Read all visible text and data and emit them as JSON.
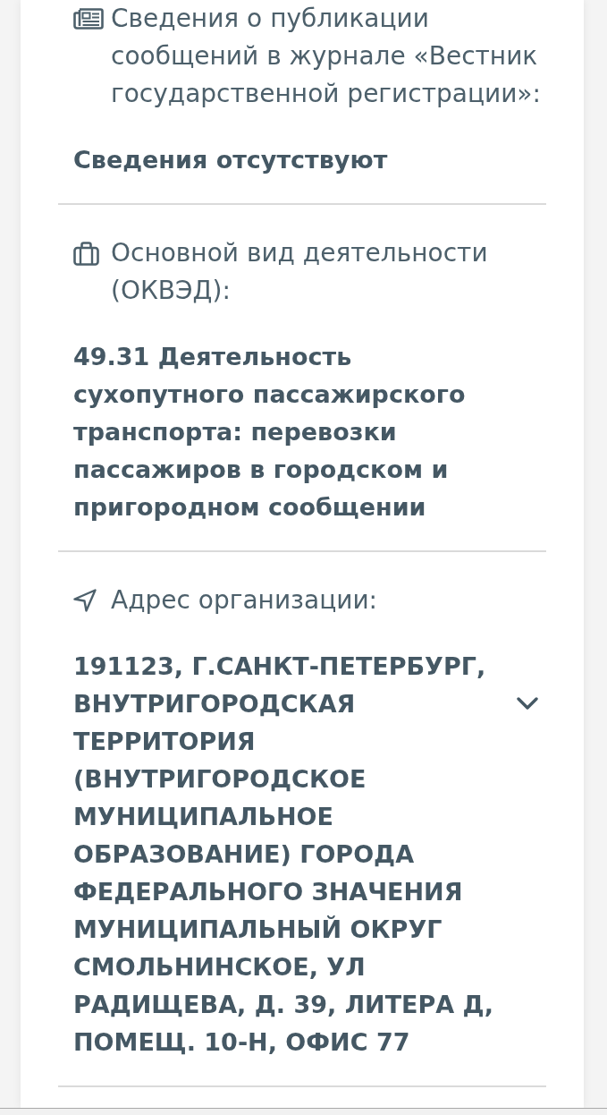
{
  "publication_info": {
    "label": "Сведения о публикации сообщений в журнале «Вестник государственной регистрации»:",
    "value": "Сведения отсутствуют"
  },
  "main_activity": {
    "label": "Основной вид деятельности (ОКВЭД):",
    "value": "49.31 Деятельность сухопутного пассажирского транспорта: перевозки пассажиров в городском и пригородном сообщении"
  },
  "organization_address": {
    "label": "Адрес организации:",
    "value": "191123, Г.САНКТ-ПЕТЕРБУРГ, ВНУТРИГОРОДСКАЯ ТЕРРИТОРИЯ (ВНУТРИГОРОДСКОЕ МУНИЦИПАЛЬНОЕ ОБРАЗОВАНИЕ) ГОРОДА ФЕДЕРАЛЬНОГО ЗНАЧЕНИЯ МУНИЦИПАЛЬНЫЙ ОКРУГ СМОЛЬНИНСКОЕ, УЛ РАДИЩЕВА, Д. 39, ЛИТЕРА Д, ПОМЕЩ. 10-Н, ОФИС 77",
    "expanded": false
  }
}
